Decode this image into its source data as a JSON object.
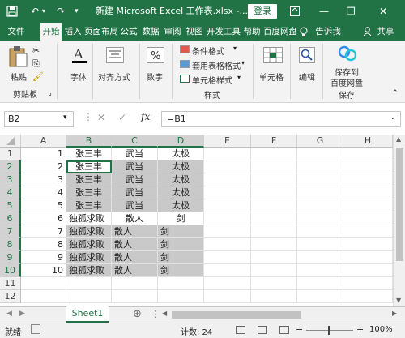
{
  "titlebar": {
    "title": "新建 Microsoft Excel 工作表.xlsx  -...",
    "login": "登录",
    "minimize": "—",
    "restore": "❐",
    "close": "✕",
    "undo": "↶",
    "redo": "↷"
  },
  "tabs": [
    "文件",
    "开始",
    "插入",
    "页面布局",
    "公式",
    "数据",
    "审阅",
    "视图",
    "开发工具",
    "帮助",
    "百度网盘",
    "告诉我",
    "共享"
  ],
  "ribbon": {
    "paste": "粘贴",
    "clipboard": "剪贴板",
    "font": "字体",
    "align": "对齐方式",
    "number": "数字",
    "cond_format": "条件格式",
    "table_format": "套用表格格式",
    "cell_style": "单元格样式",
    "styles": "样式",
    "cells": "单元格",
    "edit": "编辑",
    "save_baidu_1": "保存到",
    "save_baidu_2": "百度网盘",
    "save": "保存"
  },
  "formula": {
    "namebox": "B2",
    "cancel": "✕",
    "enter": "✓",
    "fx": "fx",
    "content": "=B1"
  },
  "columns": [
    "A",
    "B",
    "C",
    "D",
    "E",
    "F",
    "G",
    "H"
  ],
  "rows": [
    {
      "n": "1",
      "a": "1",
      "b": "张三丰",
      "c": "武当",
      "d": "太极"
    },
    {
      "n": "2",
      "a": "2",
      "b": "张三丰",
      "c": "武当",
      "d": "太极"
    },
    {
      "n": "3",
      "a": "3",
      "b": "张三丰",
      "c": "武当",
      "d": "太极"
    },
    {
      "n": "4",
      "a": "4",
      "b": "张三丰",
      "c": "武当",
      "d": "太极"
    },
    {
      "n": "5",
      "a": "5",
      "b": "张三丰",
      "c": "武当",
      "d": "太极"
    },
    {
      "n": "6",
      "a": "6",
      "b": "独孤求败",
      "c": "散人",
      "d": "剑"
    },
    {
      "n": "7",
      "a": "7",
      "b": "独孤求败",
      "c": "散人",
      "d": "剑"
    },
    {
      "n": "8",
      "a": "8",
      "b": "独孤求败",
      "c": "散人",
      "d": "剑"
    },
    {
      "n": "9",
      "a": "9",
      "b": "独孤求败",
      "c": "散人",
      "d": "剑"
    },
    {
      "n": "10",
      "a": "10",
      "b": "独孤求败",
      "c": "散人",
      "d": "剑"
    },
    {
      "n": "11",
      "a": "",
      "b": "",
      "c": "",
      "d": ""
    },
    {
      "n": "12",
      "a": "",
      "b": "",
      "c": "",
      "d": ""
    }
  ],
  "sheets": {
    "active": "Sheet1",
    "add": "⊕"
  },
  "status": {
    "mode": "就绪",
    "count": "计数: 24",
    "zoom": "100%",
    "minus": "−",
    "plus": "+"
  },
  "colors": {
    "accent": "#217346",
    "selection": "#c9c9c9"
  }
}
